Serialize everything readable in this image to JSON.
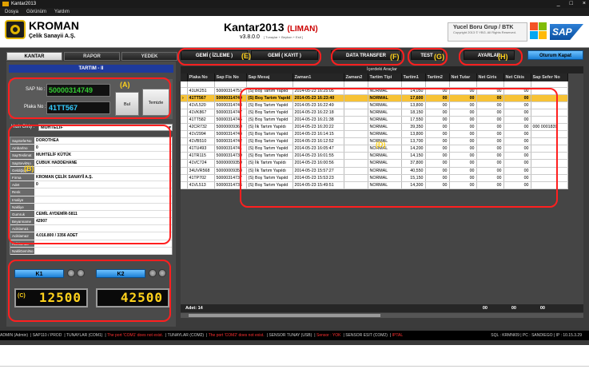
{
  "window": {
    "title": "Kantar2013",
    "controls": [
      "_",
      "□",
      "×"
    ]
  },
  "menu": [
    "Dosya",
    "Görünüm",
    "Yardım"
  ],
  "header": {
    "brand": "KROMAN",
    "brand_sub": "Çelik Sanayii A.Ş.",
    "app_title": "Kantar2013",
    "app_title_suffix": "(LIMAN)",
    "version": "v3.8.0.0",
    "version_sub": "[ Tunaylar + Beykon + Esit ]",
    "company": "Yucel Boru Grup / BTK",
    "copyright": "Copyright 2013 © YBG. All Rights Reserved.",
    "sap_logo": "SAP"
  },
  "tabs": [
    "KANTAR",
    "RAPOR",
    "YEDEK"
  ],
  "left": {
    "title": "TARTIM - II",
    "sap_no_label": "SAP No :",
    "sap_no": "50000314749",
    "plaka_label": "Plaka No :",
    "plaka": "41TT567",
    "bul": "Bul",
    "temizle": "Temizle",
    "hizli_label": "Hızlı Giriş :",
    "hizli_value": "MUHTELİF",
    "info": [
      {
        "k": "SapSeferNo",
        "v": "DOROTHEA"
      },
      {
        "k": "Ambarİno",
        "v": "0"
      },
      {
        "k": "SapTeslimat",
        "v": "MUHTELİF KÜTÜK"
      },
      {
        "k": "SapSevkNo",
        "v": "ÇUBUK HADDEHANE"
      },
      {
        "k": "Geldiğiyer",
        "v": ""
      },
      {
        "k": "Firma",
        "v": "KROMAN ÇELİK SANAYİİ A.Ş."
      },
      {
        "k": "Adet",
        "v": "0"
      },
      {
        "k": "Renk",
        "v": ""
      },
      {
        "k": "Irsaliye",
        "v": ""
      },
      {
        "k": "Nakliye",
        "v": ""
      },
      {
        "k": "Gumruk",
        "v": "CEMİL AYDEMİR-5811"
      },
      {
        "k": "Beyanname",
        "v": "42907"
      },
      {
        "k": "Aciklama1",
        "v": ""
      },
      {
        "k": "Aciklama2",
        "v": "4.016.800 / 3356 ADET"
      },
      {
        "k": "Aciklama3",
        "v": ""
      },
      {
        "k": "NakliGemiNo",
        "v": ""
      }
    ],
    "k1_label": "K1",
    "k2_label": "K2",
    "k1_value": "12500",
    "k2_value": "42500"
  },
  "toolbar": {
    "gemi_izleme": "GEMİ ( İZLEME )",
    "gemi_kayit": "GEMİ ( KAYIT )",
    "data_transfer": "DATA TRANSFER",
    "test": "TEST",
    "ayarlar": "AYARLAR",
    "oturum_kapat": "Oturum Kapat"
  },
  "grid": {
    "title": "İçerdeki Araçlar",
    "columns": [
      "",
      "Plaka No",
      "Sap Fis No",
      "Sap Mesaj",
      "Zaman1",
      "Zaman2",
      "Tartim Tipi",
      "Tartim1",
      "Tartim2",
      "Net Tutar",
      "Net Giris",
      "Net Cikis",
      "Sap Sefer No"
    ],
    "rows": [
      [
        "",
        "41UK251",
        "50000314751",
        "(S) Boş Tartım Yapıld",
        "2014-05-23  16:25:05",
        "",
        "NORMAL",
        "14,050",
        "00",
        "00",
        "00",
        "00",
        ""
      ],
      [
        "›",
        "41TT567",
        "50000314749",
        "(S) Boş Tartım Yapıld",
        "2014-05-23  16:23:40",
        "",
        "NORMAL",
        "17,600",
        "00",
        "00",
        "00",
        "00",
        ""
      ],
      [
        "",
        "41VL520",
        "50000314748",
        "(S) Boş Tartım Yapıld",
        "2014-05-23  16:22:49",
        "",
        "NORMAL",
        "13,800",
        "00",
        "00",
        "00",
        "00",
        ""
      ],
      [
        "",
        "41VK867",
        "50000314747",
        "(S) Boş Tartım Yapıld",
        "2014-05-23  16:22:18",
        "",
        "NORMAL",
        "18,150",
        "00",
        "00",
        "00",
        "00",
        ""
      ],
      [
        "",
        "41TT582",
        "50000314745",
        "(S) Boş Tartım Yapıld",
        "2014-05-23  16:21:38",
        "",
        "NORMAL",
        "17,550",
        "00",
        "00",
        "00",
        "00",
        ""
      ],
      [
        "",
        "42CR732",
        "50000009360",
        "(S) İlk Tartım Yapıldı",
        "2014-05-23  16:20:22",
        "",
        "NORMAL",
        "39,350",
        "00",
        "00",
        "00",
        "00",
        "000 0001839"
      ],
      [
        "",
        "41V2994",
        "50000314744",
        "(S) Boş Tartım Yapıld",
        "2014-05-23  16:14:15",
        "",
        "NORMAL",
        "13,800",
        "00",
        "00",
        "00",
        "00",
        ""
      ],
      [
        "",
        "41VB510",
        "50000314742",
        "(S) Boş Tartım Yapıld",
        "2014-05-23  16:12:52",
        "",
        "NORMAL",
        "13,700",
        "00",
        "00",
        "00",
        "00",
        ""
      ],
      [
        "",
        "41TU493",
        "50000314741",
        "(S) Boş Tartım Yapıld",
        "2014-05-23  16:05:47",
        "",
        "NORMAL",
        "14,200",
        "00",
        "00",
        "00",
        "00",
        ""
      ],
      [
        "",
        "41TR115",
        "50000314739",
        "(S) Boş Tartım Yapıld",
        "2014-05-23  16:01:55",
        "",
        "NORMAL",
        "14,150",
        "00",
        "00",
        "00",
        "00",
        ""
      ],
      [
        "",
        "41VC724",
        "50000009359",
        "(S) İlk Tartım Yapıldı",
        "2014-05-23  16:00:56",
        "",
        "NORMAL",
        "37,800",
        "00",
        "00",
        "00",
        "00",
        ""
      ],
      [
        "",
        "34UVR568",
        "50000009358",
        "(S) İlk Tartım Yapıldı",
        "2014-05-23  15:57:27",
        "",
        "NORMAL",
        "40,550",
        "00",
        "00",
        "00",
        "00",
        ""
      ],
      [
        "",
        "41TP702",
        "50000314737",
        "(S) Boş Tartım Yapıld",
        "2014-05-23  15:53:23",
        "",
        "NORMAL",
        "15,150",
        "00",
        "00",
        "00",
        "00",
        ""
      ],
      [
        "",
        "41VL513",
        "50000314736",
        "(S) Boş Tartım Yapıld",
        "2014-05-23  15:49:51",
        "",
        "NORMAL",
        "14,300",
        "00",
        "00",
        "00",
        "00",
        ""
      ]
    ],
    "footer_count": "Adet: 14",
    "footer_sum1": "00",
    "footer_sum2": "00",
    "footer_sum3": "00"
  },
  "annotations": {
    "a": "(A)",
    "b": "(B)",
    "c": "(C)",
    "d": "(D)",
    "e": "(E)",
    "f": "(F)",
    "g": "(G)",
    "h": "(H)"
  },
  "status": {
    "items": [
      "ADMIN (Admin)",
      "SAP110 / PROD",
      "TUNAYLAR (COM1)"
    ],
    "err1": "The port 'COM1' does not exist.",
    "tunaylar2": "TUNAYLAR (COM2)",
    "err2": "The port 'COM2' does not exist.",
    "sensor_tunay": "SENSOR TUNAY (USB)",
    "sensor_yok": "Sensor : YOK",
    "sensor_esit": "SENSOR ESIT (COM2)",
    "iptal": "IPTAL",
    "right": "SQL : KRMNI09 | PC : SANDIEGO | IP : 10.15.3.29"
  },
  "colors": {
    "accent": "#1b7fd6",
    "selected_row": "#f7c235",
    "annotation": "#ff1f1f",
    "lcd": "#ffd21c"
  }
}
